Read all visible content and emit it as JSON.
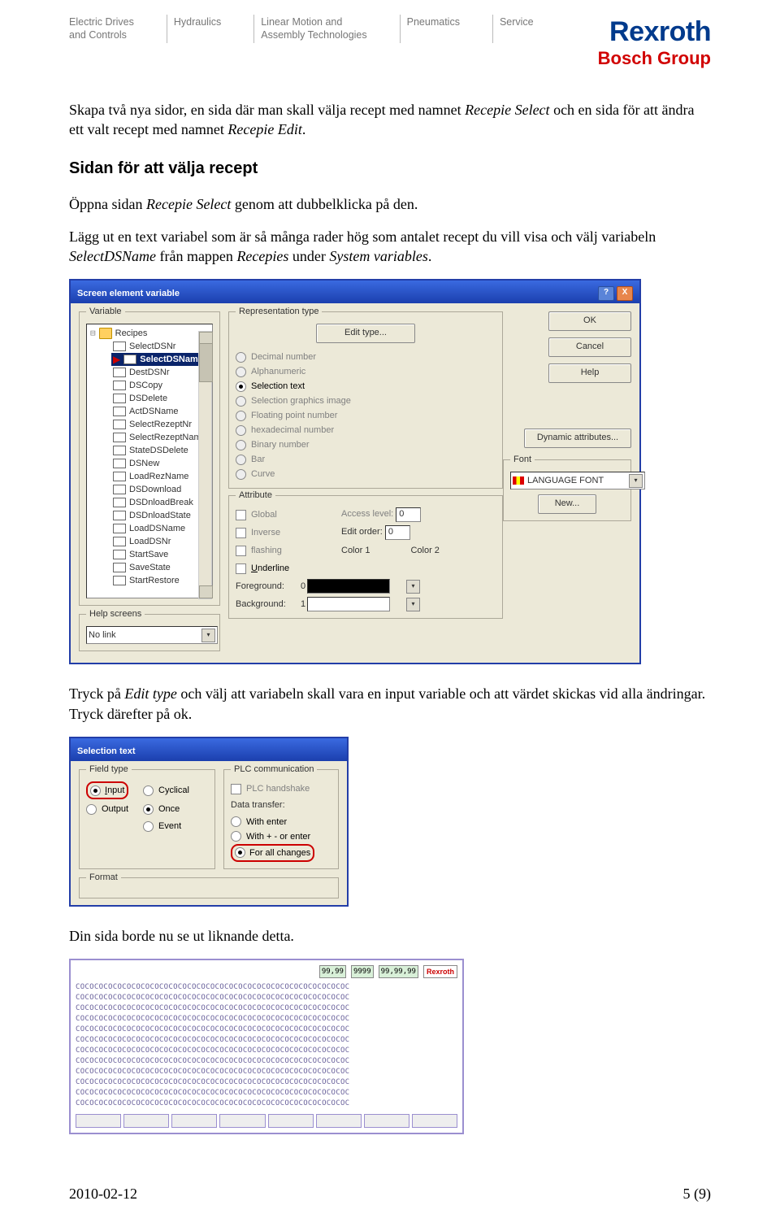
{
  "header": {
    "cols": [
      "Electric Drives\nand Controls",
      "Hydraulics",
      "Linear Motion and\nAssembly Technologies",
      "Pneumatics",
      "Service"
    ],
    "logo_line1": "Rexroth",
    "logo_line2": "Bosch Group"
  },
  "body": {
    "p1a": "Skapa två nya sidor, en sida där man skall välja recept med namnet ",
    "p1b": "Recepie Select",
    "p1c": " och en sida för att ändra ett valt recept med namnet ",
    "p1d": "Recepie Edit",
    "p1e": ".",
    "h2": "Sidan för att välja recept",
    "p2a": "Öppna sidan ",
    "p2b": "Recepie Select",
    "p2c": " genom att dubbelklicka på den.",
    "p3a": "Lägg ut en text variabel som är så många rader hög som antalet recept du vill visa och välj variabeln ",
    "p3b": "SelectDSName",
    "p3c": " från mappen ",
    "p3d": "Recepies",
    "p3e": " under ",
    "p3f": "System variables",
    "p3g": ".",
    "p4a": "Tryck på ",
    "p4b": "Edit type",
    "p4c": " och välj att variabeln skall vara en input variable och att värdet skickas vid alla ändringar. Tryck därefter på ok.",
    "p5": "Din sida borde nu se ut liknande detta."
  },
  "dialog1": {
    "title": "Screen element variable",
    "help_q": "?",
    "close_x": "X",
    "gb_variable": "Variable",
    "tree_folder": "Recipes",
    "tree_items": [
      "SelectDSNr",
      "SelectDSName",
      "DestDSNr",
      "DSCopy",
      "DSDelete",
      "ActDSName",
      "SelectRezeptNr",
      "SelectRezeptName",
      "StateDSDelete",
      "DSNew",
      "LoadRezName",
      "DSDownload",
      "DSDnloadBreak",
      "DSDnloadState",
      "LoadDSName",
      "LoadDSNr",
      "StartSave",
      "SaveState",
      "StartRestore"
    ],
    "tree_selected_index": 1,
    "gb_help": "Help screens",
    "help_value": "No link",
    "gb_rep": "Representation type",
    "btn_edit_type": "Edit type...",
    "rt": {
      "decimal": "Decimal number",
      "alpha": "Alphanumeric",
      "selection": "Selection text",
      "graphics": "Selection graphics image",
      "float": "Floating point number",
      "hex": "hexadecimal number",
      "binary": "Binary number",
      "bar": "Bar",
      "curve": "Curve"
    },
    "btn_ok": "OK",
    "btn_cancel": "Cancel",
    "btn_help": "Help",
    "btn_dyn": "Dynamic attributes...",
    "btn_new": "New...",
    "gb_font": "Font",
    "font_value": "LANGUAGE FONT",
    "gb_attr": "Attribute",
    "attr": {
      "global": "Global",
      "inverse": "Inverse",
      "flashing": "flashing",
      "underline": "Underline"
    },
    "access_level": "Access level:",
    "access_value": "0",
    "edit_order": "Edit order:",
    "edit_value": "0",
    "color1": "Color 1",
    "color2": "Color 2",
    "foreground": "Foreground:",
    "fg_value": "0",
    "background": "Background:",
    "bg_value": "1"
  },
  "dialog2": {
    "title": "Selection text",
    "gb_field": "Field type",
    "ft": {
      "input": "Input",
      "output": "Output",
      "cyclical": "Cyclical",
      "once": "Once",
      "event": "Event"
    },
    "gb_plc": "PLC communication",
    "plc_handshake": "PLC handshake",
    "data_transfer": "Data transfer:",
    "dt": {
      "with_enter": "With enter",
      "with_plus": "With + - or enter",
      "all": "For all changes"
    },
    "gb_format": "Format"
  },
  "preview": {
    "nums": [
      "99,99",
      "9999",
      "99,99,99"
    ],
    "rex": "Rexroth",
    "line": "COCOCOCOCOCOCOCOCOCOCOCOCOCOCOCOCOCOCOCOCOCOCOCOCOCOCOCOCOC"
  },
  "footer": {
    "date": "2010-02-12",
    "page": "5 (9)"
  }
}
